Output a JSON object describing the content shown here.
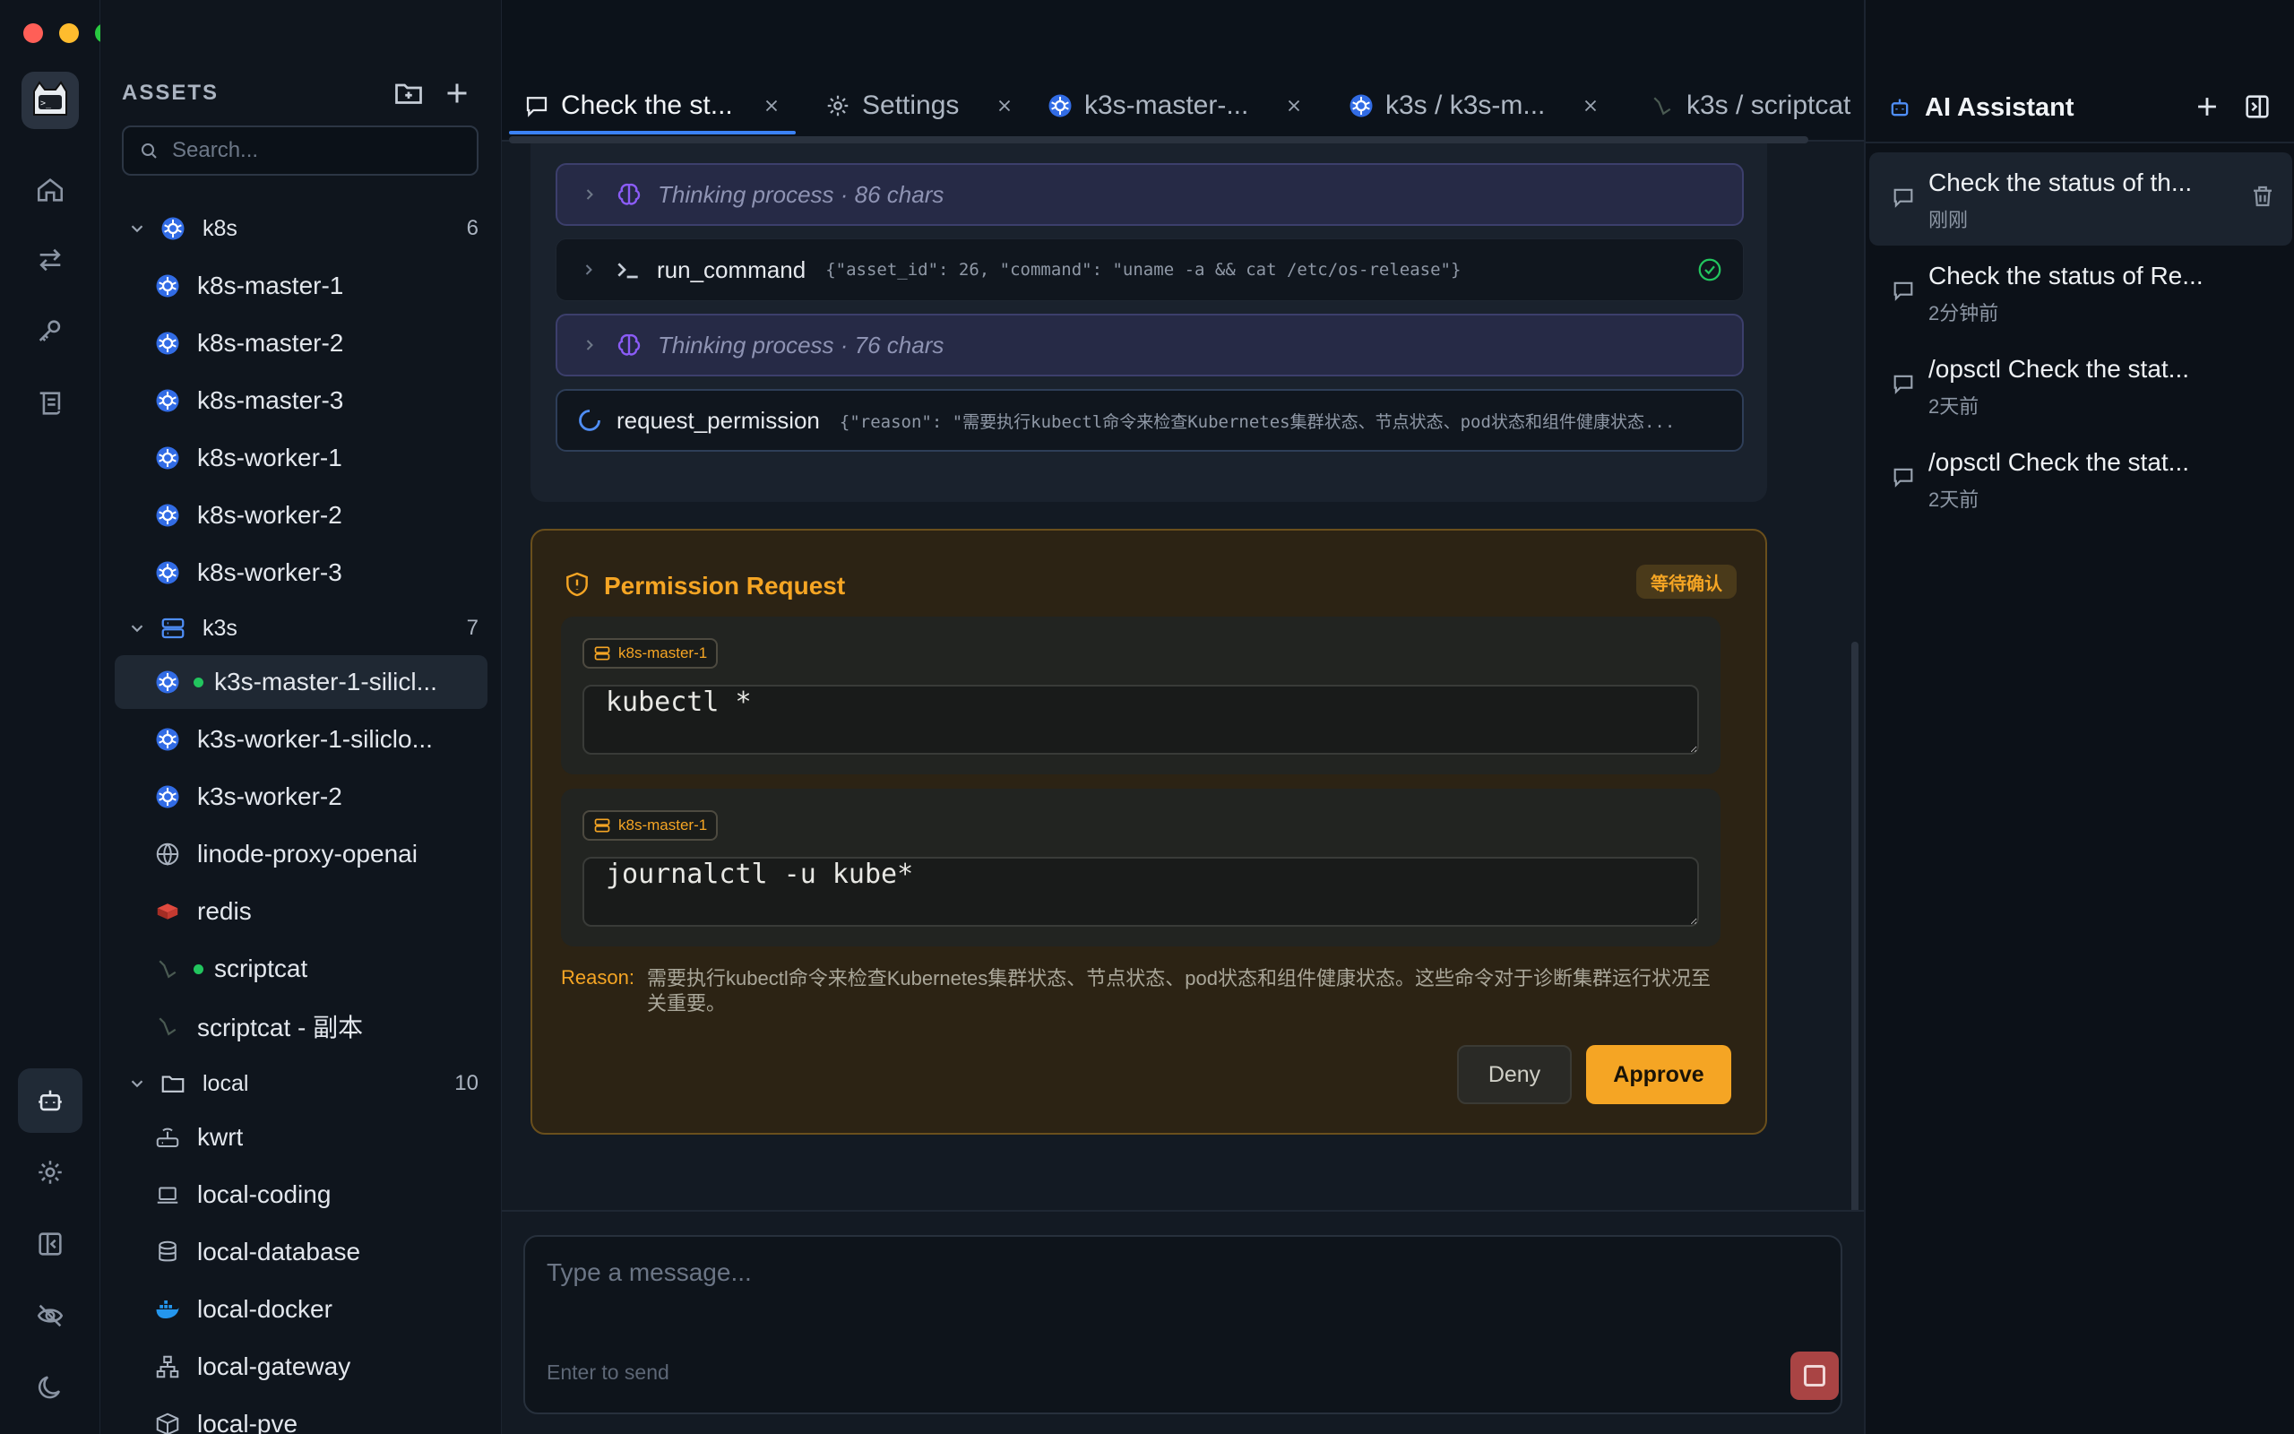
{
  "sidebar": {
    "title": "ASSETS",
    "search_placeholder": "Search...",
    "groups": [
      {
        "name": "k8s",
        "count": "6",
        "items": [
          {
            "label": "k8s-master-1"
          },
          {
            "label": "k8s-master-2"
          },
          {
            "label": "k8s-master-3"
          },
          {
            "label": "k8s-worker-1"
          },
          {
            "label": "k8s-worker-2"
          },
          {
            "label": "k8s-worker-3"
          }
        ]
      },
      {
        "name": "k3s",
        "count": "7",
        "items": [
          {
            "label": "k3s-master-1-silicl..."
          },
          {
            "label": "k3s-worker-1-siliclo..."
          },
          {
            "label": "k3s-worker-2"
          },
          {
            "label": "linode-proxy-openai"
          },
          {
            "label": "redis"
          },
          {
            "label": "scriptcat"
          },
          {
            "label": "scriptcat - 副本"
          }
        ]
      },
      {
        "name": "local",
        "count": "10",
        "items": [
          {
            "label": "kwrt"
          },
          {
            "label": "local-coding"
          },
          {
            "label": "local-database"
          },
          {
            "label": "local-docker"
          },
          {
            "label": "local-gateway"
          },
          {
            "label": "local-pve"
          }
        ]
      }
    ]
  },
  "tabs": [
    {
      "label": "Check the st..."
    },
    {
      "label": "Settings"
    },
    {
      "label": "k3s-master-..."
    },
    {
      "label": "k3s / k3s-m..."
    },
    {
      "label": "k3s / scriptcat"
    }
  ],
  "steps": [
    {
      "label": "Thinking process · 86 chars"
    },
    {
      "name": "run_command",
      "args": "{\"asset_id\": 26, \"command\": \"uname -a && cat /etc/os-release\"}"
    },
    {
      "label": "Thinking process · 76 chars"
    },
    {
      "name": "request_permission",
      "args": "{\"reason\": \"需要执行kubectl命令来检查Kubernetes集群状态、节点状态、pod状态和组件健康状态..."
    }
  ],
  "permission": {
    "title": "Permission Request",
    "badge": "等待确认",
    "commands": [
      {
        "asset": "k8s-master-1",
        "command": "kubectl *"
      },
      {
        "asset": "k8s-master-1",
        "command": "journalctl -u kube*"
      }
    ],
    "reason_label": "Reason:",
    "reason": "需要执行kubectl命令来检查Kubernetes集群状态、节点状态、pod状态和组件健康状态。这些命令对于诊断集群运行状况至关重要。",
    "deny_label": "Deny",
    "approve_label": "Approve"
  },
  "composer": {
    "placeholder": "Type a message...",
    "hint": "Enter to send"
  },
  "ai_panel": {
    "title": "AI Assistant",
    "conversations": [
      {
        "title": "Check the status of th...",
        "time": "刚刚"
      },
      {
        "title": "Check the status of Re...",
        "time": "2分钟前"
      },
      {
        "title": "/opsctl Check the stat...",
        "time": "2天前"
      },
      {
        "title": "/opsctl Check the stat...",
        "time": "2天前"
      }
    ]
  },
  "colors": {
    "accent": "#3b82f6",
    "warning": "#f5a524",
    "online": "#22c55e",
    "thinking": "#8b5cf6",
    "success": "#22c55e"
  },
  "icons": {
    "kubernetes": "kubernetes-icon",
    "server-group": "server-stack-icon",
    "folder": "folder-icon",
    "globe": "globe-icon",
    "redis": "redis-icon",
    "scriptcat": "scriptcat-icon",
    "router": "router-icon",
    "laptop": "laptop-icon",
    "database": "database-icon",
    "docker": "docker-icon",
    "network": "network-icon",
    "box": "box-icon"
  }
}
